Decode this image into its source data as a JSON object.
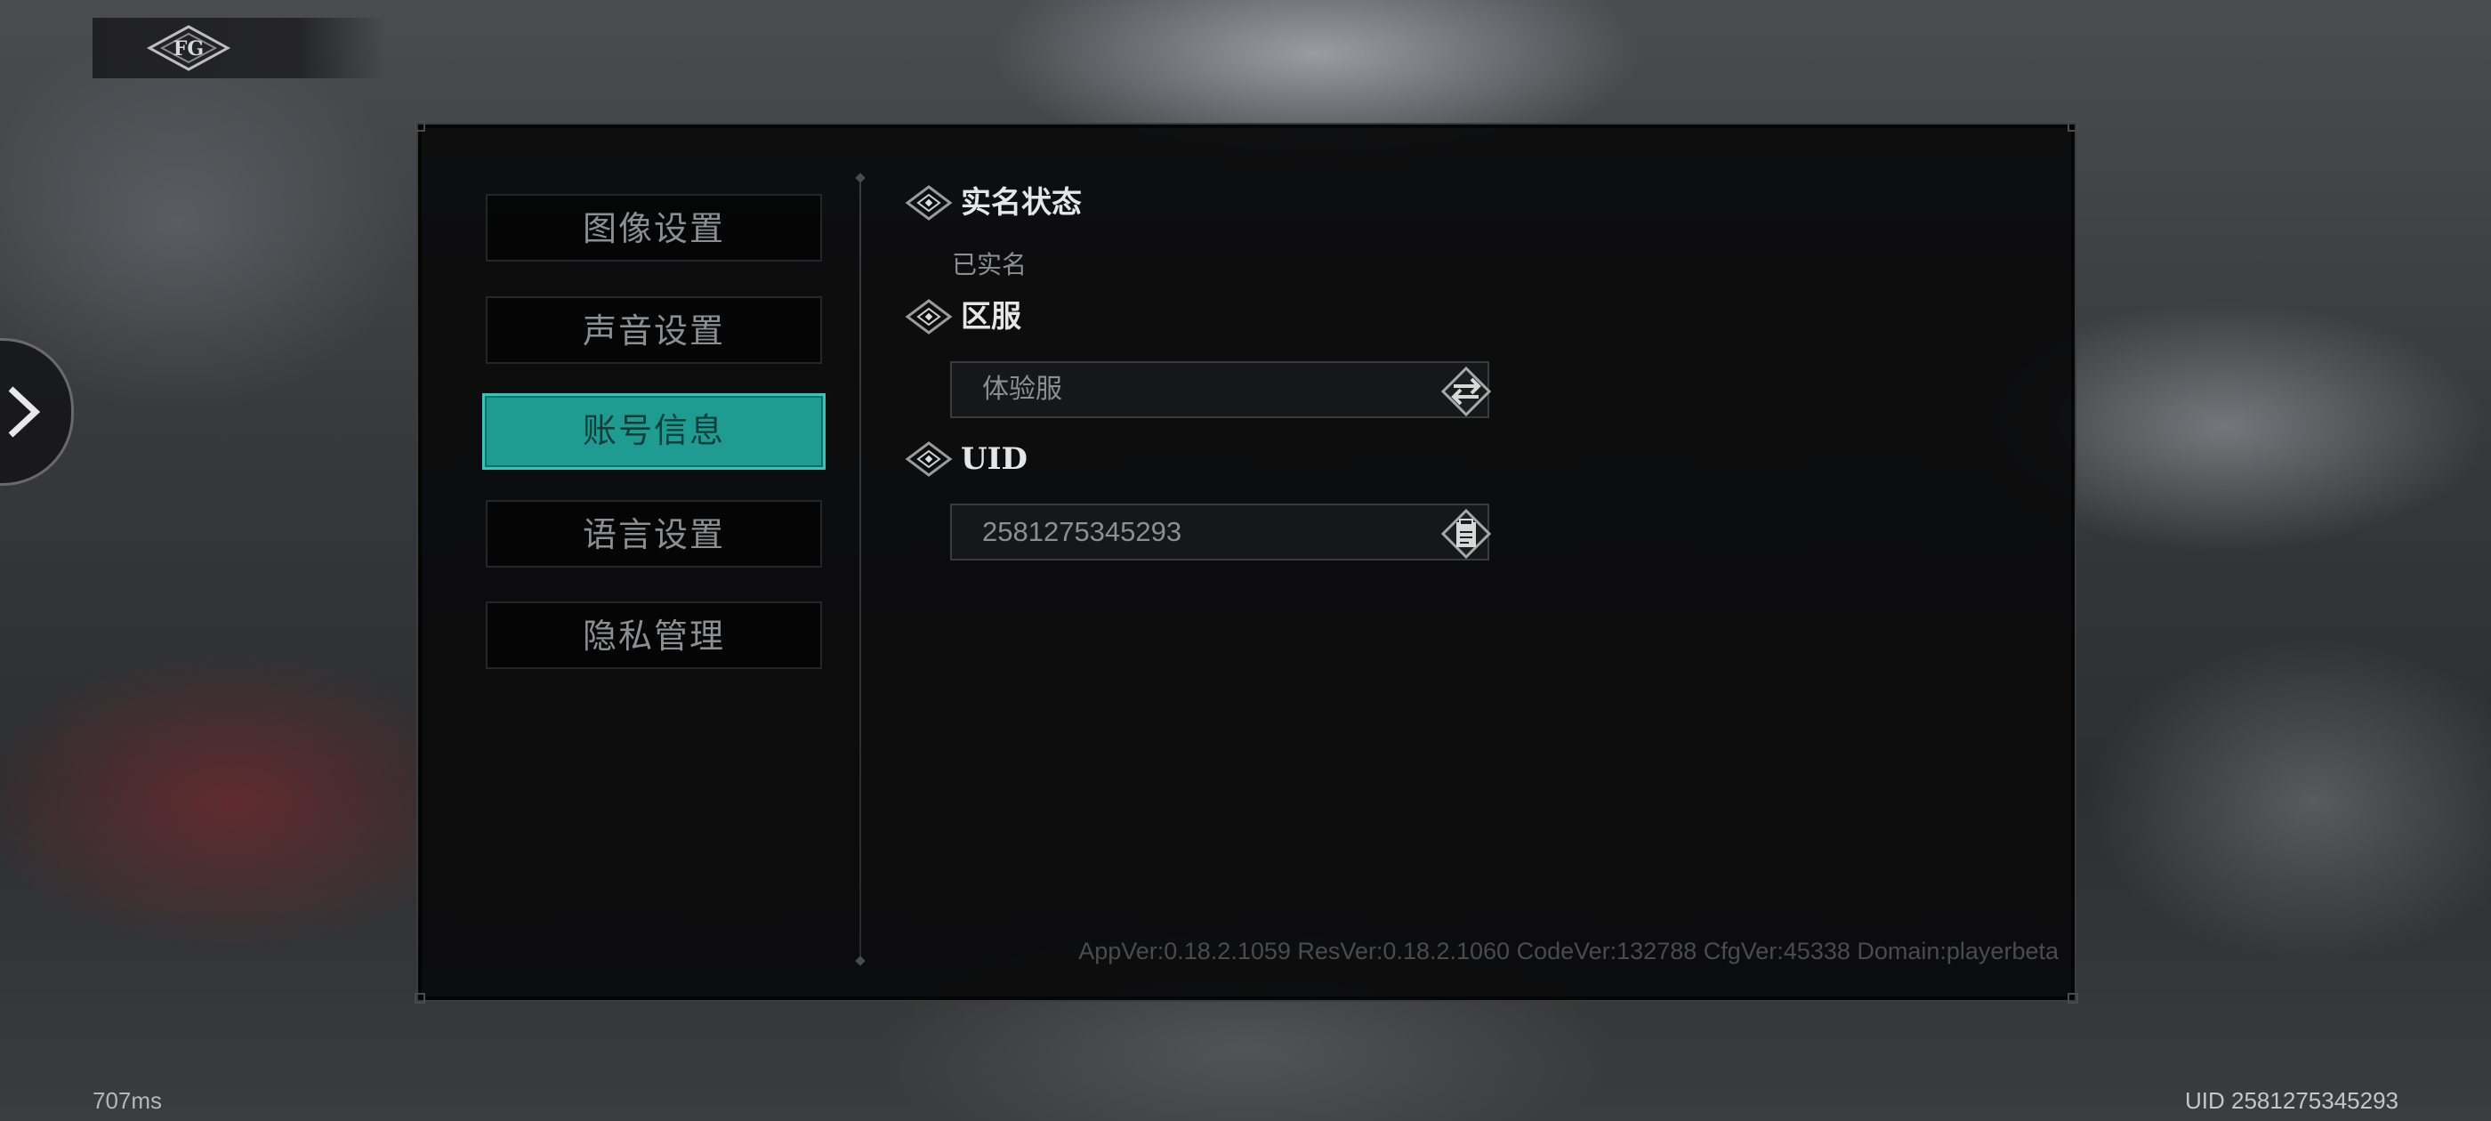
{
  "nav": {
    "items": [
      {
        "label": "图像设置"
      },
      {
        "label": "声音设置"
      },
      {
        "label": "账号信息"
      },
      {
        "label": "语言设置"
      },
      {
        "label": "隐私管理"
      }
    ],
    "active_index": 2
  },
  "account": {
    "realname": {
      "title": "实名状态",
      "value": "已实名"
    },
    "server": {
      "title": "区服",
      "value": "体验服",
      "action_icon": "swap-icon"
    },
    "uid": {
      "title": "UID",
      "value": "2581275345293",
      "action_icon": "copy-icon"
    }
  },
  "version_info": "AppVer:0.18.2.1059   ResVer:0.18.2.1060   CodeVer:132788   CfgVer:45338   Domain:playerbeta",
  "footer": {
    "latency": "707ms",
    "uid": "UID 2581275345293"
  },
  "colors": {
    "accent": "#1f9c92",
    "accent_border": "#34c6b8",
    "panel_bg": "#0a0a0b",
    "text_muted": "#8d8e90"
  },
  "icons": {
    "logo": "game-logo-icon",
    "side_toggle": "chevron-right-icon",
    "section": "diamond-icon"
  }
}
